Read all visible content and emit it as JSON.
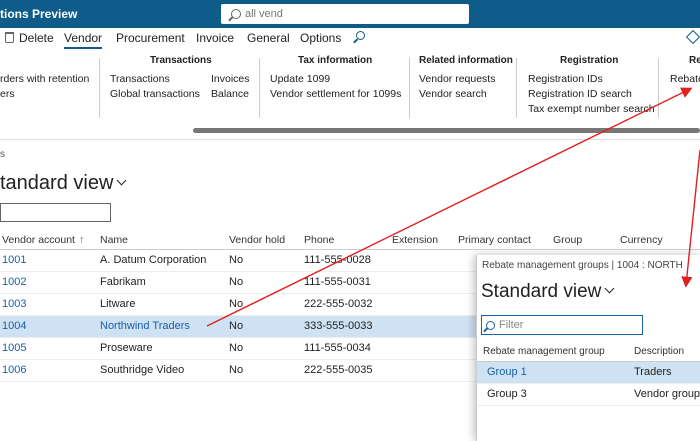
{
  "app": {
    "title": "tions Preview"
  },
  "search": {
    "placeholder": "all vend"
  },
  "actionbar": {
    "delete_label": "Delete",
    "tabs": [
      "Vendor",
      "Procurement",
      "Invoice",
      "General",
      "Options"
    ]
  },
  "ribbon": {
    "col0": {
      "items": [
        "rders with retention",
        "ers"
      ]
    },
    "transactions": {
      "title": "Transactions",
      "items": [
        "Transactions",
        "Global transactions",
        "Invoices",
        "Balance"
      ]
    },
    "tax": {
      "title": "Tax information",
      "items": [
        "Update 1099",
        "Vendor settlement for 1099s"
      ]
    },
    "related": {
      "title": "Related information",
      "items": [
        "Vendor requests",
        "Vendor search"
      ]
    },
    "registration": {
      "title": "Registration",
      "items": [
        "Registration IDs",
        "Registration ID search",
        "Tax exempt number search"
      ]
    },
    "rebate": {
      "title": "Re",
      "items": [
        "Rebate"
      ]
    }
  },
  "page": {
    "breadcrumb": "s",
    "view_title": "tandard view"
  },
  "grid": {
    "headers": [
      "Vendor account",
      "Name",
      "Vendor hold",
      "Phone",
      "Extension",
      "Primary contact",
      "Group",
      "Currency"
    ],
    "rows": [
      {
        "account": "1001",
        "name": "A. Datum Corporation",
        "hold": "No",
        "phone": "111-555-0028"
      },
      {
        "account": "1002",
        "name": "Fabrikam",
        "hold": "No",
        "phone": "111-555-0031"
      },
      {
        "account": "1003",
        "name": "Litware",
        "hold": "No",
        "phone": "222-555-0032"
      },
      {
        "account": "1004",
        "name": "Northwind Traders",
        "hold": "No",
        "phone": "333-555-0033"
      },
      {
        "account": "1005",
        "name": "Proseware",
        "hold": "No",
        "phone": "111-555-0034"
      },
      {
        "account": "1006",
        "name": "Southridge Video",
        "hold": "No",
        "phone": "222-555-0035"
      }
    ],
    "selected_index": 3
  },
  "panel": {
    "breadcrumb": "Rebate management groups  |  1004 : NORTH",
    "title": "Standard view",
    "filter_placeholder": "Filter",
    "headers": [
      "Rebate management group",
      "Description"
    ],
    "rows": [
      {
        "group": "Group 1",
        "description": "Traders"
      },
      {
        "group": "Group 3",
        "description": "Vendor group"
      }
    ]
  },
  "colors": {
    "brand": "#0f5b8a",
    "selection": "#cfe2f3",
    "link": "#1a5fa8",
    "annotation": "#e02020"
  }
}
